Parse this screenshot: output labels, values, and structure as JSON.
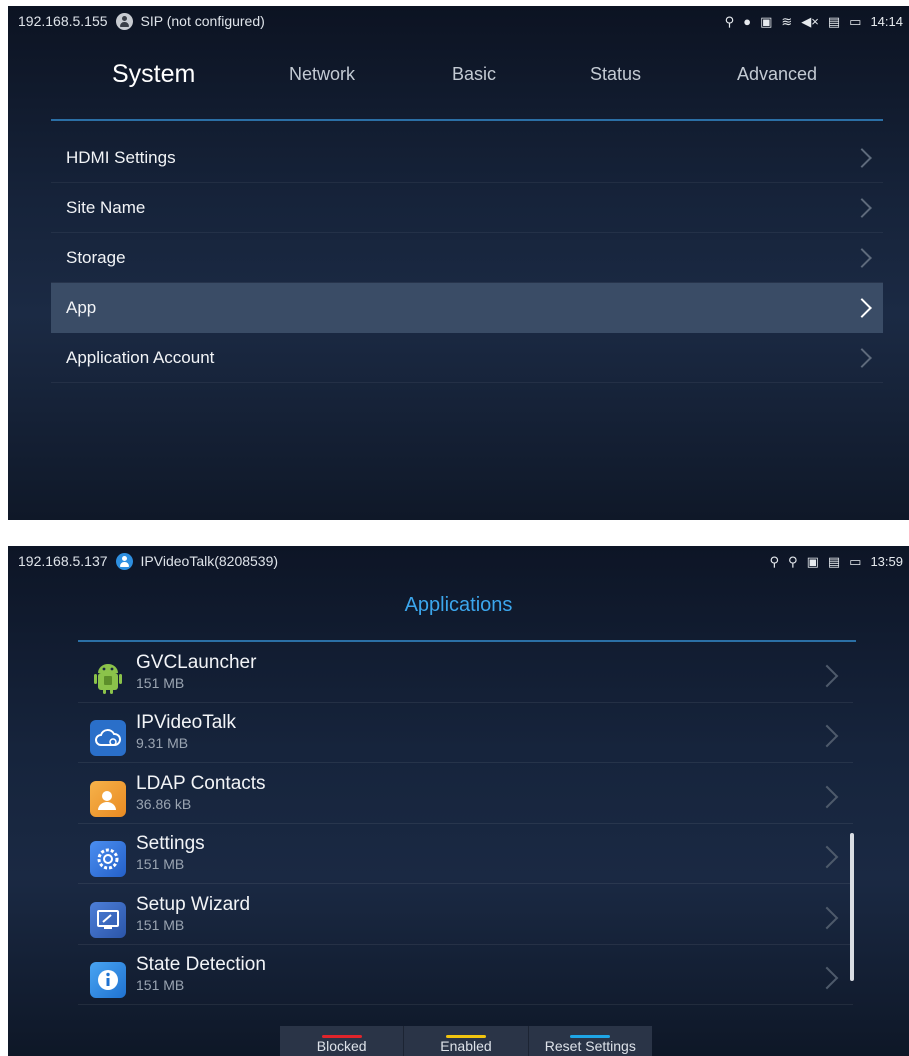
{
  "screen1": {
    "status": {
      "ip": "192.168.5.155",
      "account": "SIP (not configured)",
      "time": "14:14",
      "icons": [
        "usb-icon",
        "record-icon",
        "display-icon",
        "wifi-icon",
        "mute-icon",
        "sd-card-icon",
        "no-signal-icon"
      ]
    },
    "tabs": [
      "System",
      "Network",
      "Basic",
      "Status",
      "Advanced"
    ],
    "active_tab": "System",
    "menu": [
      {
        "label": "HDMI Settings"
      },
      {
        "label": "Site Name"
      },
      {
        "label": "Storage"
      },
      {
        "label": "App",
        "selected": true
      },
      {
        "label": "Application Account"
      }
    ]
  },
  "screen2": {
    "status": {
      "ip": "192.168.5.137",
      "account": "IPVideoTalk(8208539)",
      "time": "13:59",
      "icons": [
        "usb-icon",
        "usb-icon",
        "display-icon",
        "sd-card-icon",
        "monitor-icon"
      ]
    },
    "title": "Applications",
    "apps": [
      {
        "name": "GVCLauncher",
        "size": "151 MB",
        "icon": "android-icon"
      },
      {
        "name": "IPVideoTalk",
        "size": "9.31 MB",
        "icon": "cloud-icon"
      },
      {
        "name": "LDAP Contacts",
        "size": "36.86 kB",
        "icon": "contacts-icon"
      },
      {
        "name": "Settings",
        "size": "151 MB",
        "icon": "settings-gear-icon"
      },
      {
        "name": "Setup Wizard",
        "size": "151 MB",
        "icon": "wizard-icon"
      },
      {
        "name": "State Detection",
        "size": "151 MB",
        "icon": "info-icon"
      }
    ],
    "bottom_buttons": [
      {
        "label": "Blocked",
        "color": "#e0242b"
      },
      {
        "label": "Enabled",
        "color": "#f1c40f"
      },
      {
        "label": "Reset Settings",
        "color": "#1ea5e6"
      }
    ]
  },
  "colors": {
    "accent_blue": "#3ca6ec",
    "selected_row": "#3a4c66"
  }
}
